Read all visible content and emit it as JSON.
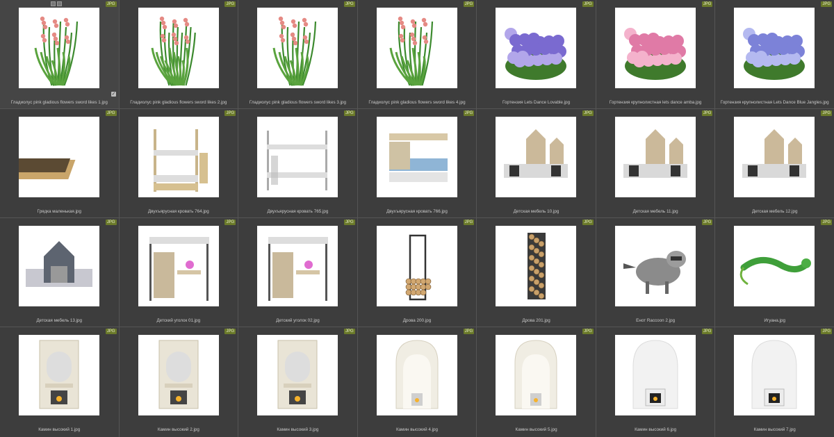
{
  "badge_label": "JPG",
  "items": [
    {
      "name": "Гладиолус pink gladious flowers sword likes 1.jpg",
      "icon": "gladiolus-1",
      "selected": true
    },
    {
      "name": "Гладиолус pink gladious flowers sword likes 2.jpg",
      "icon": "gladiolus-2"
    },
    {
      "name": "Гладиолус pink gladious flowers sword likes 3.jpg",
      "icon": "gladiolus-3"
    },
    {
      "name": "Гладиолус pink gladious flowers sword likes 4.jpg",
      "icon": "gladiolus-4"
    },
    {
      "name": "Гортензия Lets Dance Lovable.jpg",
      "icon": "hydrangea-purple"
    },
    {
      "name": "Гортензия крупнолистная lets dance amba.jpg",
      "icon": "hydrangea-pink"
    },
    {
      "name": "Гортензия крупнолистная Lets Dance Blue Jangles.jpg",
      "icon": "hydrangea-blue"
    },
    {
      "name": "Грядка маленькая.jpg",
      "icon": "garden-bed"
    },
    {
      "name": "Двухъярусная кровать 764.jpg",
      "icon": "bunk-bed"
    },
    {
      "name": "Двухъярусная кровать 765.jpg",
      "icon": "bunk-bed-metal"
    },
    {
      "name": "Двухъярусная кровать 766.jpg",
      "icon": "bunk-bed-shelves"
    },
    {
      "name": "Детская мебель 10.jpg",
      "icon": "kids-furniture-10"
    },
    {
      "name": "Детская мебель 11.jpg",
      "icon": "kids-furniture-11"
    },
    {
      "name": "Детская мебель 12.jpg",
      "icon": "kids-furniture-12"
    },
    {
      "name": "Детская мебель 13.jpg",
      "icon": "kids-furniture-13"
    },
    {
      "name": "Детский уголок 01.jpg",
      "icon": "kids-corner-01"
    },
    {
      "name": "Детский уголок 02.jpg",
      "icon": "kids-corner-02"
    },
    {
      "name": "Дрова 200.jpg",
      "icon": "firewood-200"
    },
    {
      "name": "Дрова 201.jpg",
      "icon": "firewood-201"
    },
    {
      "name": "Енот Raccoon 2.jpg",
      "icon": "raccoon"
    },
    {
      "name": "Игуана.jpg",
      "icon": "iguana"
    },
    {
      "name": "Камин высокий 1.jpg",
      "icon": "fireplace-1"
    },
    {
      "name": "Камин высокий 2.jpg",
      "icon": "fireplace-2"
    },
    {
      "name": "Камин высокий 3.jpg",
      "icon": "fireplace-3"
    },
    {
      "name": "Камин высокий 4.jpg",
      "icon": "fireplace-4"
    },
    {
      "name": "Камин высокий 5.jpg",
      "icon": "fireplace-5"
    },
    {
      "name": "Камин высокий 6.jpg",
      "icon": "fireplace-6"
    },
    {
      "name": "Камин высокий 7.jpg",
      "icon": "fireplace-7"
    }
  ]
}
